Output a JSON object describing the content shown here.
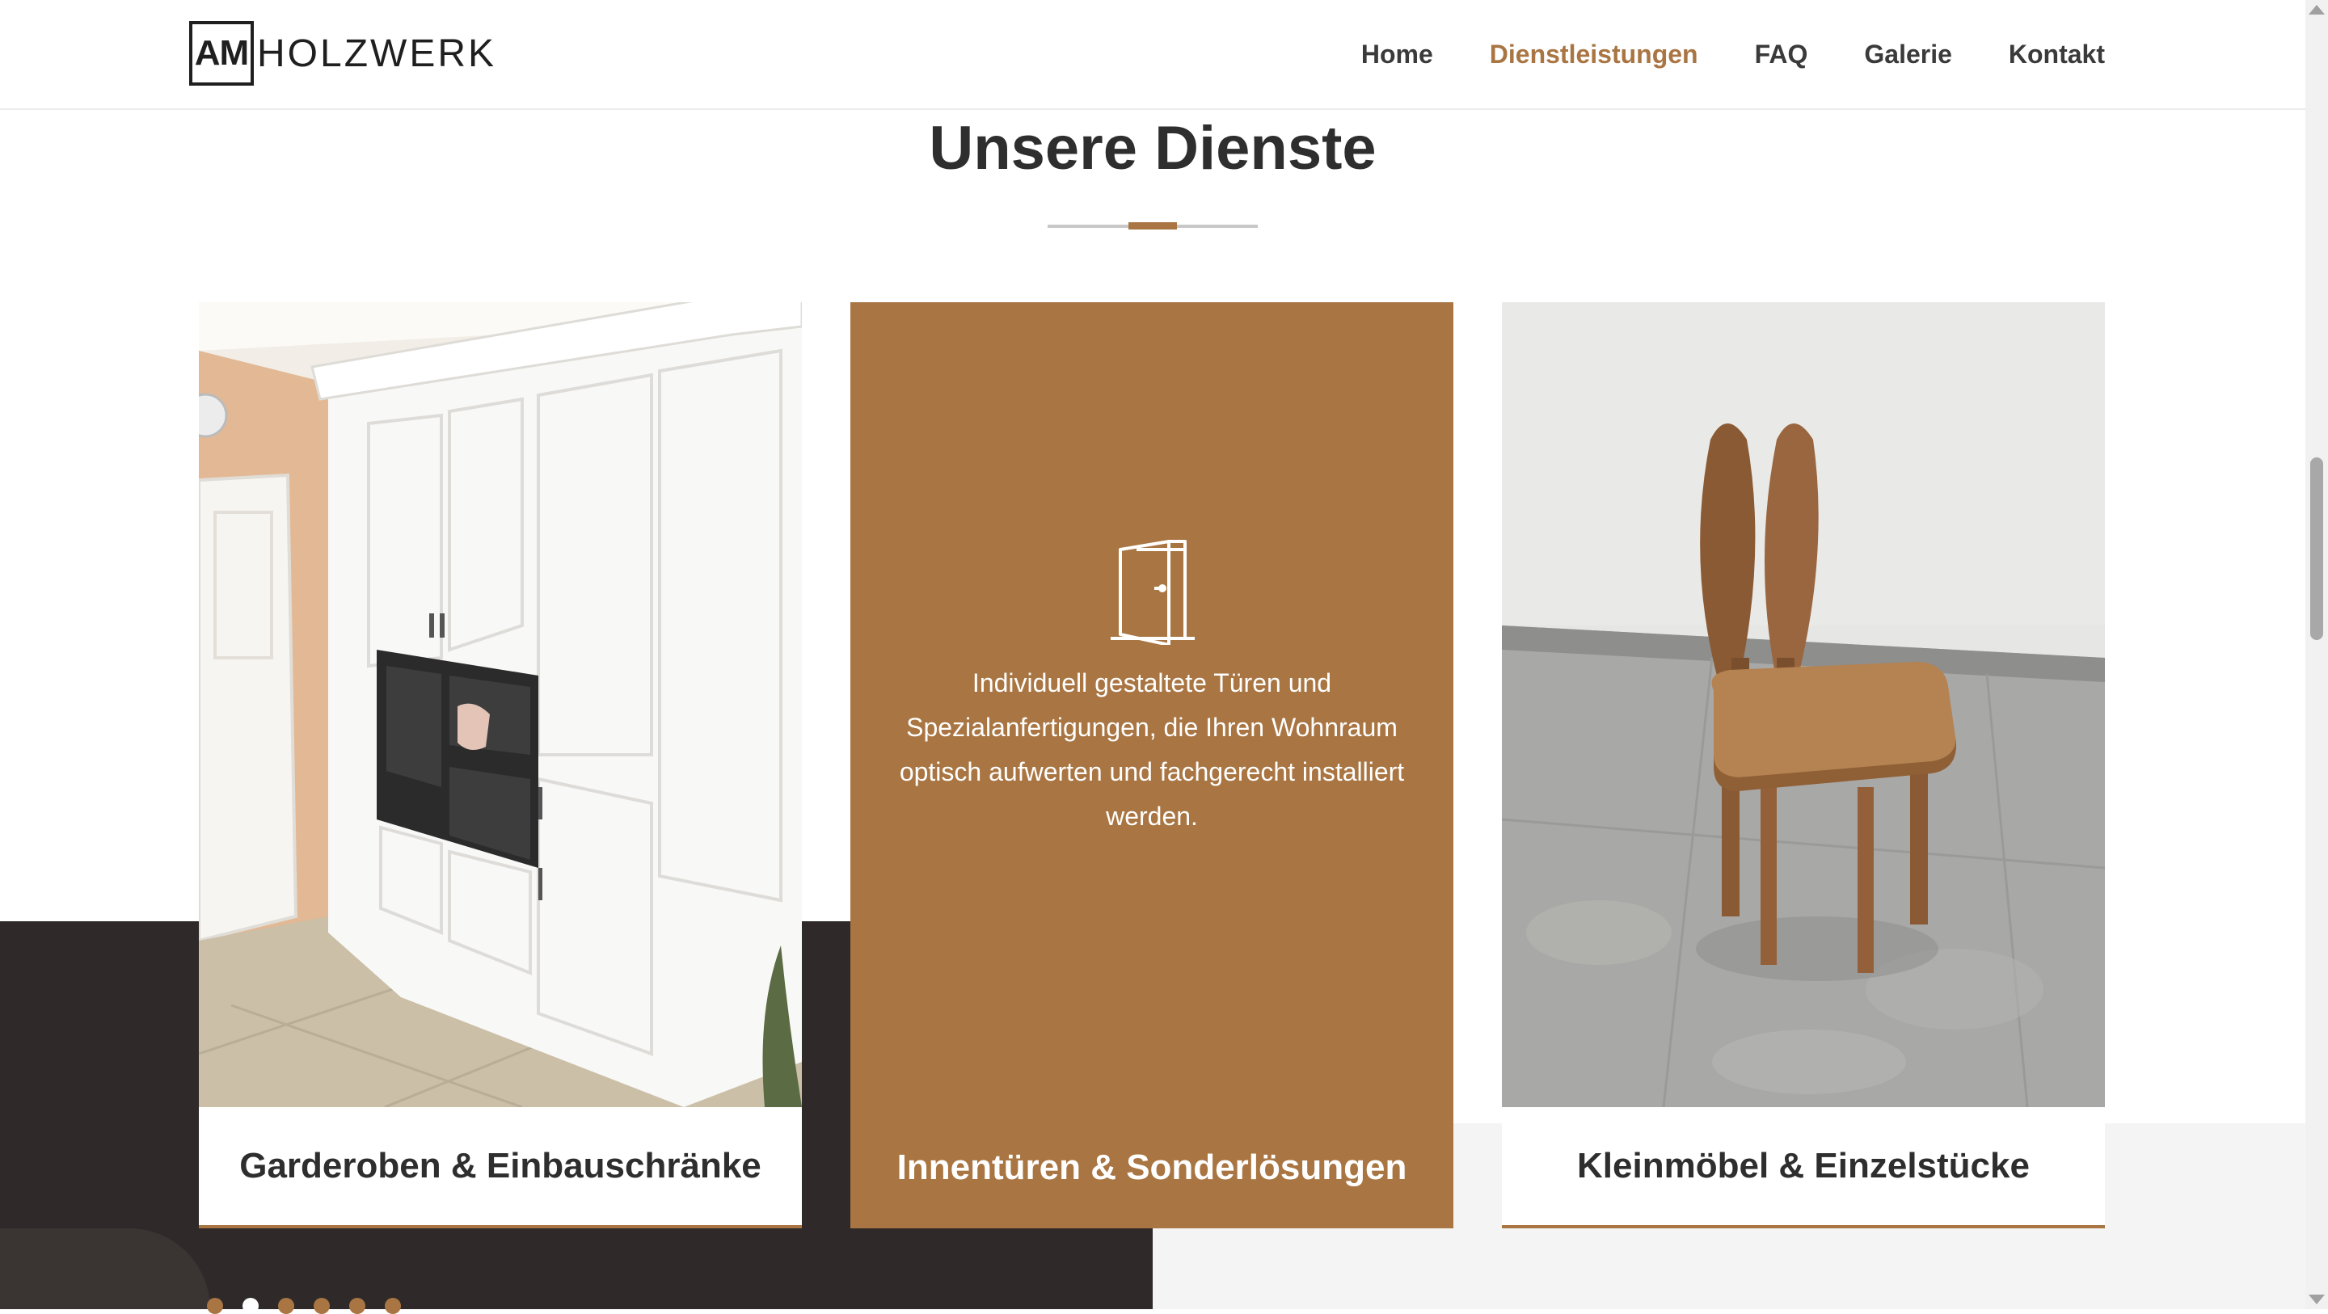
{
  "header": {
    "logo_mark": "AM",
    "logo_text": "HOLZWERK",
    "nav": [
      {
        "label": "Home",
        "active": false
      },
      {
        "label": "Dienstleistungen",
        "active": true
      },
      {
        "label": "FAQ",
        "active": false
      },
      {
        "label": "Galerie",
        "active": false
      },
      {
        "label": "Kontakt",
        "active": false
      }
    ]
  },
  "section": {
    "title": "Unsere Dienste"
  },
  "cards": [
    {
      "caption": "Garderoben & Einbauschränke",
      "image": "white-wardrobe-kitchen-cabinets-photo"
    },
    {
      "caption": "Innentüren & Sonderlösungen",
      "icon": "door-icon",
      "description": "Individuell gestaltete Türen und Spezialanfertigungen, die Ihren Wohnraum optisch aufwerten und fachgerecht installiert werden."
    },
    {
      "caption": "Kleinmöbel & Einzelstücke",
      "image": "wooden-bunny-chair-photo"
    }
  ],
  "pagination": {
    "count": 6,
    "active_index": 1
  },
  "colors": {
    "accent": "#a97542",
    "dark": "#2f2a29",
    "light": "#f4f4f4",
    "text": "#2e2e2e"
  }
}
